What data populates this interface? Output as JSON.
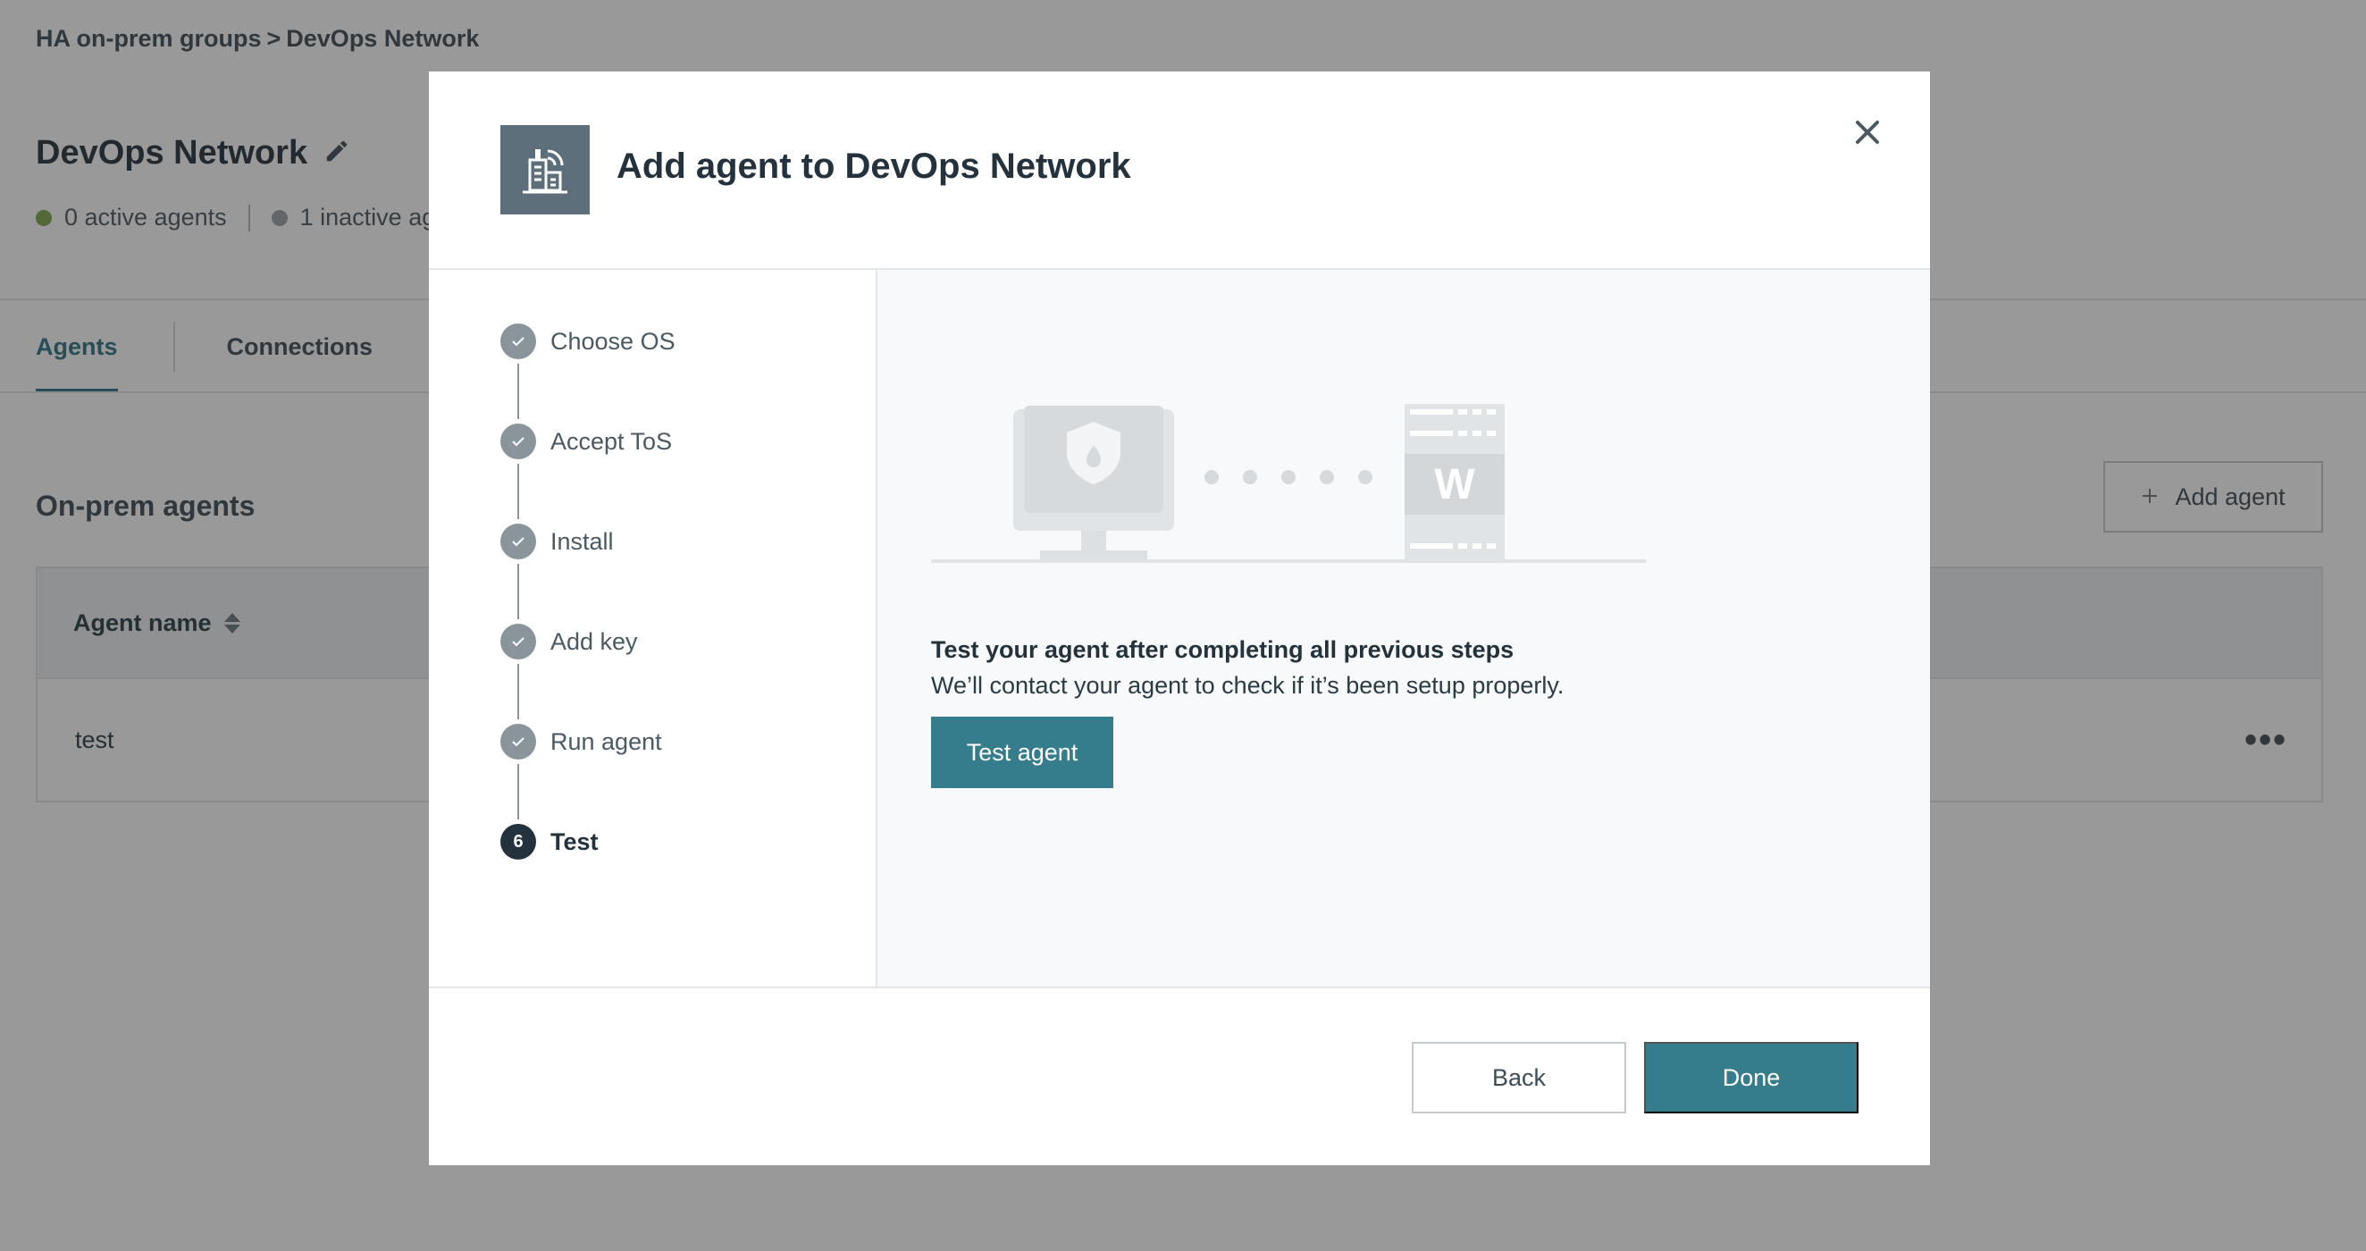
{
  "background": {
    "breadcrumb": {
      "parent": "HA on-prem groups",
      "separator": ">",
      "current": "DevOps Network"
    },
    "page_title": "DevOps Network",
    "status": {
      "active": "0 active agents",
      "inactive": "1 inactive ag"
    },
    "tabs": [
      {
        "label": "Agents",
        "active": true
      },
      {
        "label": "Connections",
        "active": false
      }
    ],
    "section_title": "On-prem agents",
    "add_agent_label": "Add agent",
    "table": {
      "header": "Agent name",
      "rows": [
        {
          "name": "test"
        }
      ]
    },
    "colors": {
      "active_dot": "#7aa84a",
      "inactive_dot": "#9aa2a7",
      "accent": "#2f7383"
    }
  },
  "modal": {
    "title": "Add agent to DevOps Network",
    "steps": [
      {
        "label": "Choose OS",
        "state": "done"
      },
      {
        "label": "Accept ToS",
        "state": "done"
      },
      {
        "label": "Install",
        "state": "done"
      },
      {
        "label": "Add key",
        "state": "done"
      },
      {
        "label": "Run agent",
        "state": "done"
      },
      {
        "label": "Test",
        "state": "current",
        "number": "6"
      }
    ],
    "illustration": {
      "server_letter": "W"
    },
    "content": {
      "heading": "Test your agent after completing all previous steps",
      "text": "We’ll contact your agent to check if it’s been setup properly.",
      "test_button": "Test agent"
    },
    "footer": {
      "back": "Back",
      "done": "Done"
    },
    "colors": {
      "primary": "#357d8c",
      "step_done": "#8a959b",
      "step_current": "#23323c"
    }
  }
}
